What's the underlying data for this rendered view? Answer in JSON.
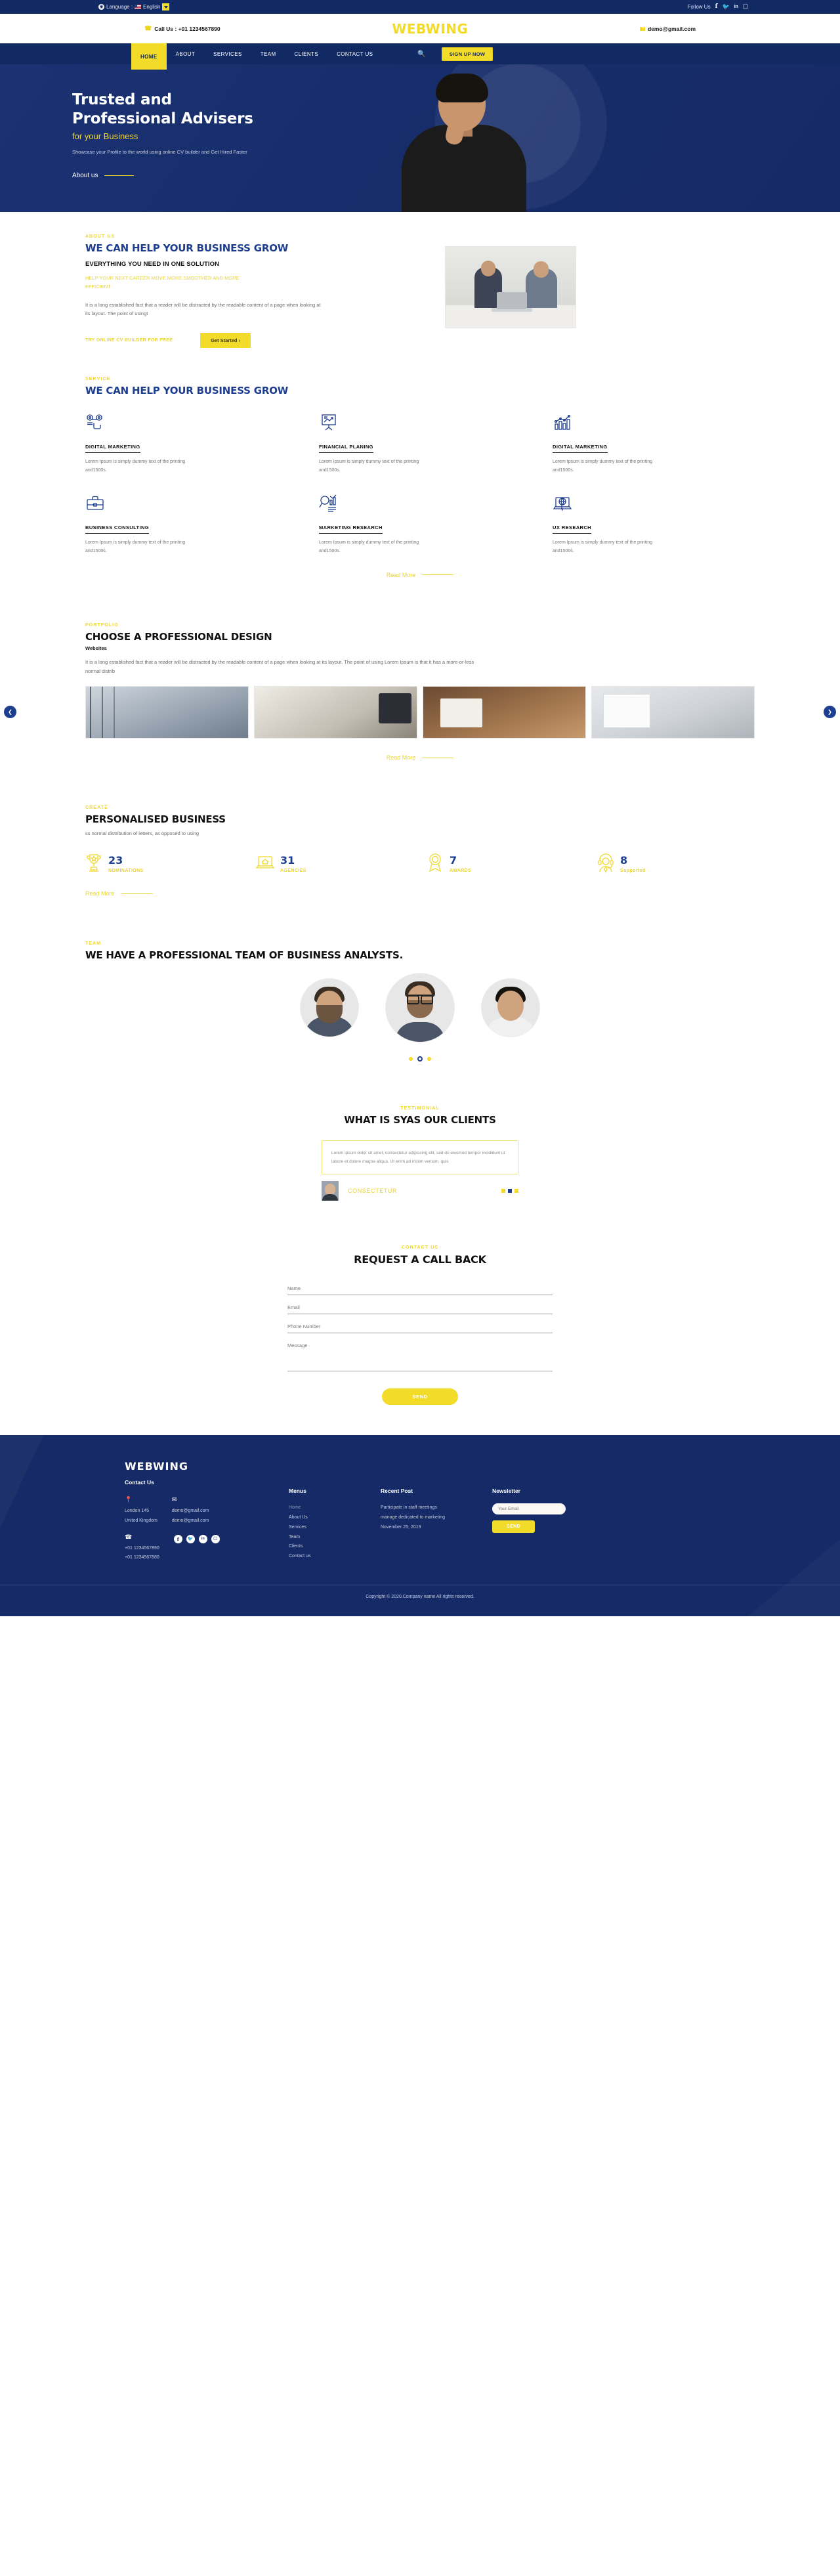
{
  "topbar": {
    "globe_icon": "globe-icon",
    "language_label": "Language :",
    "language_value": "English",
    "flag_icon": "us-flag-icon",
    "caret_icon": "chevron-down-icon",
    "follow_label": "Follow Us",
    "social": [
      {
        "icon": "facebook-icon",
        "glyph": "f"
      },
      {
        "icon": "twitter-icon",
        "glyph": "ᴛ"
      },
      {
        "icon": "linkedin-icon",
        "glyph": "in"
      },
      {
        "icon": "instagram-icon",
        "glyph": "▣"
      }
    ]
  },
  "midbar": {
    "phone_icon": "phone-icon",
    "phone_label": "Call Us : +01 1234567890",
    "brand": "WEBWING",
    "mail_icon": "envelope-icon",
    "email_label": "demo@gmail.com"
  },
  "nav": {
    "items": [
      {
        "label": "HOME",
        "active": true
      },
      {
        "label": "ABOUT",
        "active": false
      },
      {
        "label": "SERVICES",
        "active": false
      },
      {
        "label": "TEAM",
        "active": false
      },
      {
        "label": "CLIENTS",
        "active": false
      },
      {
        "label": "CONTACT US",
        "active": false
      }
    ],
    "search_icon": "search-icon",
    "signup_label": "SIGN UP NOW"
  },
  "hero": {
    "title_line1": "Trusted and",
    "title_line2": "Professional Advisers",
    "subtitle": "for your Business",
    "description": "Showcase your Profile to the world using online CV builder and Get Hired Faster",
    "about_link": "About us"
  },
  "about": {
    "eyebrow": "ABOUT US",
    "heading": "WE CAN HELP YOUR BUSINESS GROW",
    "subheading": "EVERYTHING YOU NEED IN ONE SOLUTION",
    "highlight": "HELP YOUR NEXT CAREER MOVE MORE SMOOTHER AND MORE EFFICIENT",
    "body": "It is a long established fact that a reader will be distracted by the readable content of a page when looking at its layout. The point of usingt",
    "cv_link": "TRY ONLINE CV BUILDER FOR FREE",
    "button": "Get Started  ›"
  },
  "services": {
    "eyebrow": "SERVICE",
    "heading": "WE CAN HELP YOUR BUSINESS GROW",
    "cards": [
      {
        "icon": "gears-touch-icon",
        "title": "DIGITAL MARKETING",
        "desc": "Lorem Ipsum is simply dummy text of the printing and1500s."
      },
      {
        "icon": "presentation-chart-icon",
        "title": "FINANCIAL PLANING",
        "desc": "Lorem Ipsum is simply dummy text of the printing and1500s."
      },
      {
        "icon": "bar-chart-growth-icon",
        "title": "DIGITAL MARKETING",
        "desc": "Lorem Ipsum is simply dummy text of the printing and1500s."
      },
      {
        "icon": "briefcase-icon",
        "title": "BUSINESS CONSULTING",
        "desc": "Lorem Ipsum is simply dummy text of the printing and1500s."
      },
      {
        "icon": "magnifier-chart-icon",
        "title": "MARKETING RESEARCH",
        "desc": "Lorem Ipsum is simply dummy text of the printing and1500s."
      },
      {
        "icon": "laptop-globe-icon",
        "title": "UX RESEARCH",
        "desc": "Lorem Ipsum is simply dummy text of the printing and1500s."
      }
    ],
    "read_more": "Read More"
  },
  "portfolio": {
    "eyebrow": "PORTFOLIO",
    "heading": "CHOOSE A PROFESSIONAL DESIGN",
    "subheading": "Websites",
    "body": "It is a long established fact that a reader will be distracted by the readable content of a page when looking at its layout. The point of using Lorem Ipsum is that it has a more-or-less normal distrib",
    "prev_icon": "chevron-left-icon",
    "next_icon": "chevron-right-icon",
    "read_more": "Read More",
    "items": [
      {
        "name": "portfolio-image-1"
      },
      {
        "name": "portfolio-image-2"
      },
      {
        "name": "portfolio-image-3"
      },
      {
        "name": "portfolio-image-4"
      }
    ]
  },
  "stats": {
    "eyebrow": "CREATE",
    "heading": "PERSONALISED BUSINESS",
    "body": "ss normal distribution of letters, as opposed to using",
    "items": [
      {
        "icon": "trophy-icon",
        "value": "23",
        "label": "NOMINATIONS"
      },
      {
        "icon": "laptop-home-icon",
        "value": "31",
        "label": "AGENCIES"
      },
      {
        "icon": "award-ribbon-icon",
        "value": "7",
        "label": "AWARDS"
      },
      {
        "icon": "headset-support-icon",
        "value": "8",
        "label": "Supported"
      }
    ],
    "read_more": "Read More"
  },
  "team": {
    "eyebrow": "TEAM",
    "heading": "WE HAVE A PROFESSIONAL TEAM OF BUSINESS ANALYSTS.",
    "members": [
      {
        "name": "team-member-1"
      },
      {
        "name": "team-member-2"
      },
      {
        "name": "team-member-3"
      }
    ],
    "dots": 3
  },
  "testimonial": {
    "eyebrow": "TESTIMONIAL",
    "heading": "WHAT IS SYAS OUR CLIENTS",
    "quote": "Lorem ipsum dolor sit amet, consectetur adipiscing elit, sed do eiusmod tempor incididunt ut labore et dolore magna aliqua. Ut enim ad minim veniam, quis",
    "author": "CONSECTETUR",
    "avatar": "testimonial-avatar"
  },
  "contact": {
    "eyebrow": "CONTACT US",
    "heading": "REQUEST A CALL BACK",
    "fields": [
      {
        "label": "Name",
        "name": "name-field"
      },
      {
        "label": "Email",
        "name": "email-field"
      },
      {
        "label": "Phone Number",
        "name": "phone-field"
      },
      {
        "label": "Message",
        "name": "message-field"
      }
    ],
    "send_label": "SEND"
  },
  "footer": {
    "brand": "WEBWING",
    "contact_heading": "Contact Us",
    "location_icon": "location-pin-icon",
    "address_line1": "London 145",
    "address_line2": "United Kingdom",
    "mail_icon": "envelope-icon",
    "email1": "demo@gmail.com",
    "email2": "demo@gmail.com",
    "phone_icon": "phone-ring-icon",
    "phone1": "+01 1234567890",
    "phone2": "+01 1234567880",
    "social": [
      {
        "icon": "facebook-icon",
        "glyph": "f"
      },
      {
        "icon": "twitter-icon",
        "glyph": "ᴛ"
      },
      {
        "icon": "linkedin-icon",
        "glyph": "in"
      },
      {
        "icon": "instagram-icon",
        "glyph": "▣"
      }
    ],
    "menus_heading": "Menus",
    "menus": [
      "Home",
      "About Us",
      "Services",
      "Team",
      "Clients",
      "Contact us"
    ],
    "recent_heading": "Recent Post",
    "recent_text": "Participate in staff meetings manage dedicated to marketing",
    "recent_date": "November 25, 2019",
    "newsletter_heading": "Newsletter",
    "newsletter_placeholder": "Your Email",
    "newsletter_button": "SEND",
    "copyright": "Copyright © 2020.Company name All rights reserved."
  },
  "colors": {
    "navy": "#152A66",
    "yellow": "#F3DB2A",
    "blue_heading": "#1D3D8F"
  }
}
